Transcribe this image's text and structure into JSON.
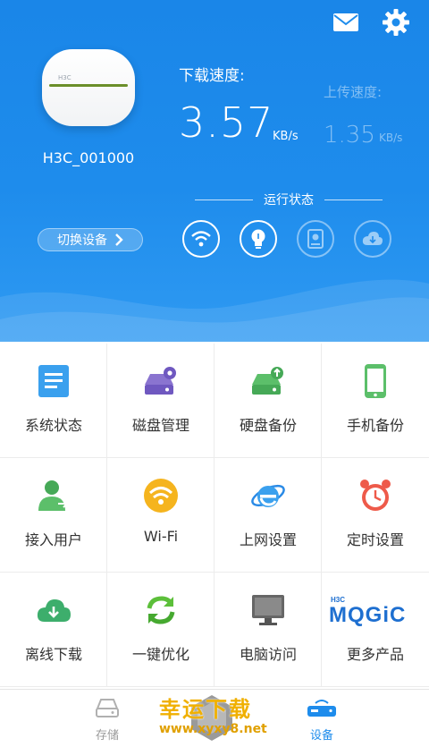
{
  "header": {
    "device_name": "H3C_001000",
    "switch_device": "切换设备",
    "download_label": "下载速度:",
    "download_value": "3.57",
    "download_unit": "KB/s",
    "upload_label": "上传速度:",
    "upload_value": "1.35",
    "upload_unit": "KB/s",
    "status_title": "运行状态"
  },
  "grid": [
    {
      "label": "系统状态",
      "icon": "document-icon"
    },
    {
      "label": "磁盘管理",
      "icon": "disk-settings-icon"
    },
    {
      "label": "硬盘备份",
      "icon": "disk-backup-icon"
    },
    {
      "label": "手机备份",
      "icon": "phone-icon"
    },
    {
      "label": "接入用户",
      "icon": "user-icon"
    },
    {
      "label": "Wi-Fi",
      "icon": "wifi-icon"
    },
    {
      "label": "上网设置",
      "icon": "ie-browser-icon"
    },
    {
      "label": "定时设置",
      "icon": "alarm-clock-icon"
    },
    {
      "label": "离线下载",
      "icon": "cloud-download-icon"
    },
    {
      "label": "一键优化",
      "icon": "refresh-icon"
    },
    {
      "label": "电脑访问",
      "icon": "monitor-icon"
    },
    {
      "label": "更多产品",
      "icon": "magic-logo-icon"
    }
  ],
  "magic_logo": {
    "small": "H3C",
    "big": "MQGiC"
  },
  "bottom_nav": {
    "storage": "存储",
    "device": "设备"
  },
  "watermark": {
    "text": "幸运下载",
    "url": "www.xyxy8.net"
  },
  "colors": {
    "header_blue": "#1e8cec",
    "active_tab": "#1e8cec",
    "watermark": "#f0b000"
  }
}
